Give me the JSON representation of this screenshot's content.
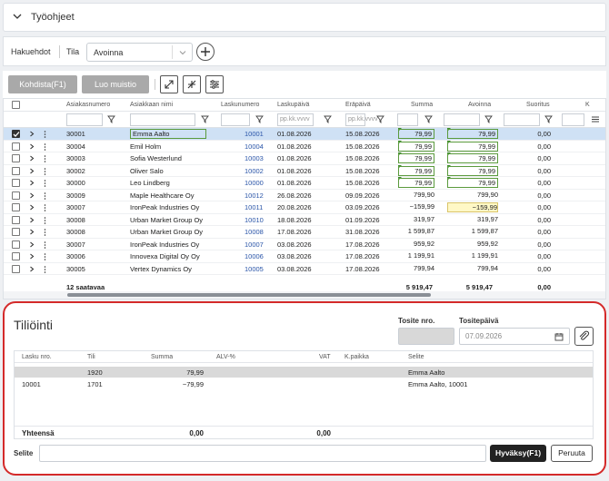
{
  "header": {
    "title": "Työohjeet"
  },
  "filters": {
    "label": "Hakuehdot",
    "status_label": "Tila",
    "status_value": "Avoinna"
  },
  "toolbar": {
    "allocate_label": "Kohdista(F1)",
    "memo_label": "Luo muistio"
  },
  "grid": {
    "columns": [
      "Asiakasnumero",
      "Asiakkaan nimi",
      "Laskunumero",
      "Laskupäivä",
      "Eräpäivä",
      "Summa",
      "Avoinna",
      "Suoritus",
      "K"
    ],
    "date_placeholder": "pp.kk.vvvv",
    "rows": [
      {
        "customer_no": "30001",
        "name": "Emma Aalto",
        "invoice_no": "10001",
        "invoice_date": "01.08.2026",
        "due_date": "15.08.2026",
        "amount": "79,99",
        "open": "79,99",
        "payment": "0,00",
        "selected": true
      },
      {
        "customer_no": "30004",
        "name": "Emil Holm",
        "invoice_no": "10004",
        "invoice_date": "01.08.2026",
        "due_date": "15.08.2026",
        "amount": "79,99",
        "open": "79,99",
        "payment": "0,00",
        "selected": false
      },
      {
        "customer_no": "30003",
        "name": "Sofia Westerlund",
        "invoice_no": "10003",
        "invoice_date": "01.08.2026",
        "due_date": "15.08.2026",
        "amount": "79,99",
        "open": "79,99",
        "payment": "0,00",
        "selected": false
      },
      {
        "customer_no": "30002",
        "name": "Oliver Salo",
        "invoice_no": "10002",
        "invoice_date": "01.08.2026",
        "due_date": "15.08.2026",
        "amount": "79,99",
        "open": "79,99",
        "payment": "0,00",
        "selected": false
      },
      {
        "customer_no": "30000",
        "name": "Leo Lindberg",
        "invoice_no": "10000",
        "invoice_date": "01.08.2026",
        "due_date": "15.08.2026",
        "amount": "79,99",
        "open": "79,99",
        "payment": "0,00",
        "selected": false
      },
      {
        "customer_no": "30009",
        "name": "Maple Healthcare Oy",
        "invoice_no": "10012",
        "invoice_date": "26.08.2026",
        "due_date": "09.09.2026",
        "amount": "799,90",
        "open": "799,90",
        "payment": "0,00",
        "selected": false
      },
      {
        "customer_no": "30007",
        "name": "IronPeak Industries Oy",
        "invoice_no": "10011",
        "invoice_date": "20.08.2026",
        "due_date": "03.09.2026",
        "amount": "−159,99",
        "open": "−159,99",
        "payment": "0,00",
        "selected": false
      },
      {
        "customer_no": "30008",
        "name": "Urban Market Group Oy",
        "invoice_no": "10010",
        "invoice_date": "18.08.2026",
        "due_date": "01.09.2026",
        "amount": "319,97",
        "open": "319,97",
        "payment": "0,00",
        "selected": false
      },
      {
        "customer_no": "30008",
        "name": "Urban Market Group Oy",
        "invoice_no": "10008",
        "invoice_date": "17.08.2026",
        "due_date": "31.08.2026",
        "amount": "1 599,87",
        "open": "1 599,87",
        "payment": "0,00",
        "selected": false
      },
      {
        "customer_no": "30007",
        "name": "IronPeak Industries Oy",
        "invoice_no": "10007",
        "invoice_date": "03.08.2026",
        "due_date": "17.08.2026",
        "amount": "959,92",
        "open": "959,92",
        "payment": "0,00",
        "selected": false
      },
      {
        "customer_no": "30006",
        "name": "Innovexa Digital Oy Oy",
        "invoice_no": "10006",
        "invoice_date": "03.08.2026",
        "due_date": "17.08.2026",
        "amount": "1 199,91",
        "open": "1 199,91",
        "payment": "0,00",
        "selected": false
      },
      {
        "customer_no": "30005",
        "name": "Vertex Dynamics Oy",
        "invoice_no": "10005",
        "invoice_date": "03.08.2026",
        "due_date": "17.08.2026",
        "amount": "799,94",
        "open": "799,94",
        "payment": "0,00",
        "selected": false
      }
    ],
    "footer": {
      "count": "12 saatavaa",
      "amount": "5 919,47",
      "open": "5 919,47",
      "payment": "0,00"
    }
  },
  "posting": {
    "title": "Tiliöinti",
    "voucher_no_label": "Tosite nro.",
    "voucher_no": "",
    "voucher_date_label": "Tositepäivä",
    "voucher_date": "07.09.2026",
    "columns": [
      "Lasku nro.",
      "Tili",
      "Summa",
      "ALV-%",
      "VAT",
      "K.paikka",
      "Selite"
    ],
    "rows": [
      {
        "invoice": "",
        "account": "1920",
        "amount": "79,99",
        "vat_pct": "",
        "vat": "",
        "cost_center": "",
        "description": "Emma Aalto"
      },
      {
        "invoice": "10001",
        "account": "1701",
        "amount": "−79,99",
        "vat_pct": "",
        "vat": "",
        "cost_center": "",
        "description": "Emma Aalto, 10001"
      }
    ],
    "total_label": "Yhteensä",
    "total_amount": "0,00",
    "total_vat": "0,00",
    "description_label": "Selite",
    "description_value": "",
    "approve_label": "Hyväksy(F1)",
    "cancel_label": "Peruuta"
  },
  "colors": {
    "selected_row": "#cfe1f5",
    "panel_border": "#d42a2a",
    "link": "#2a55a8",
    "negative_highlight": "#fff8c6"
  }
}
